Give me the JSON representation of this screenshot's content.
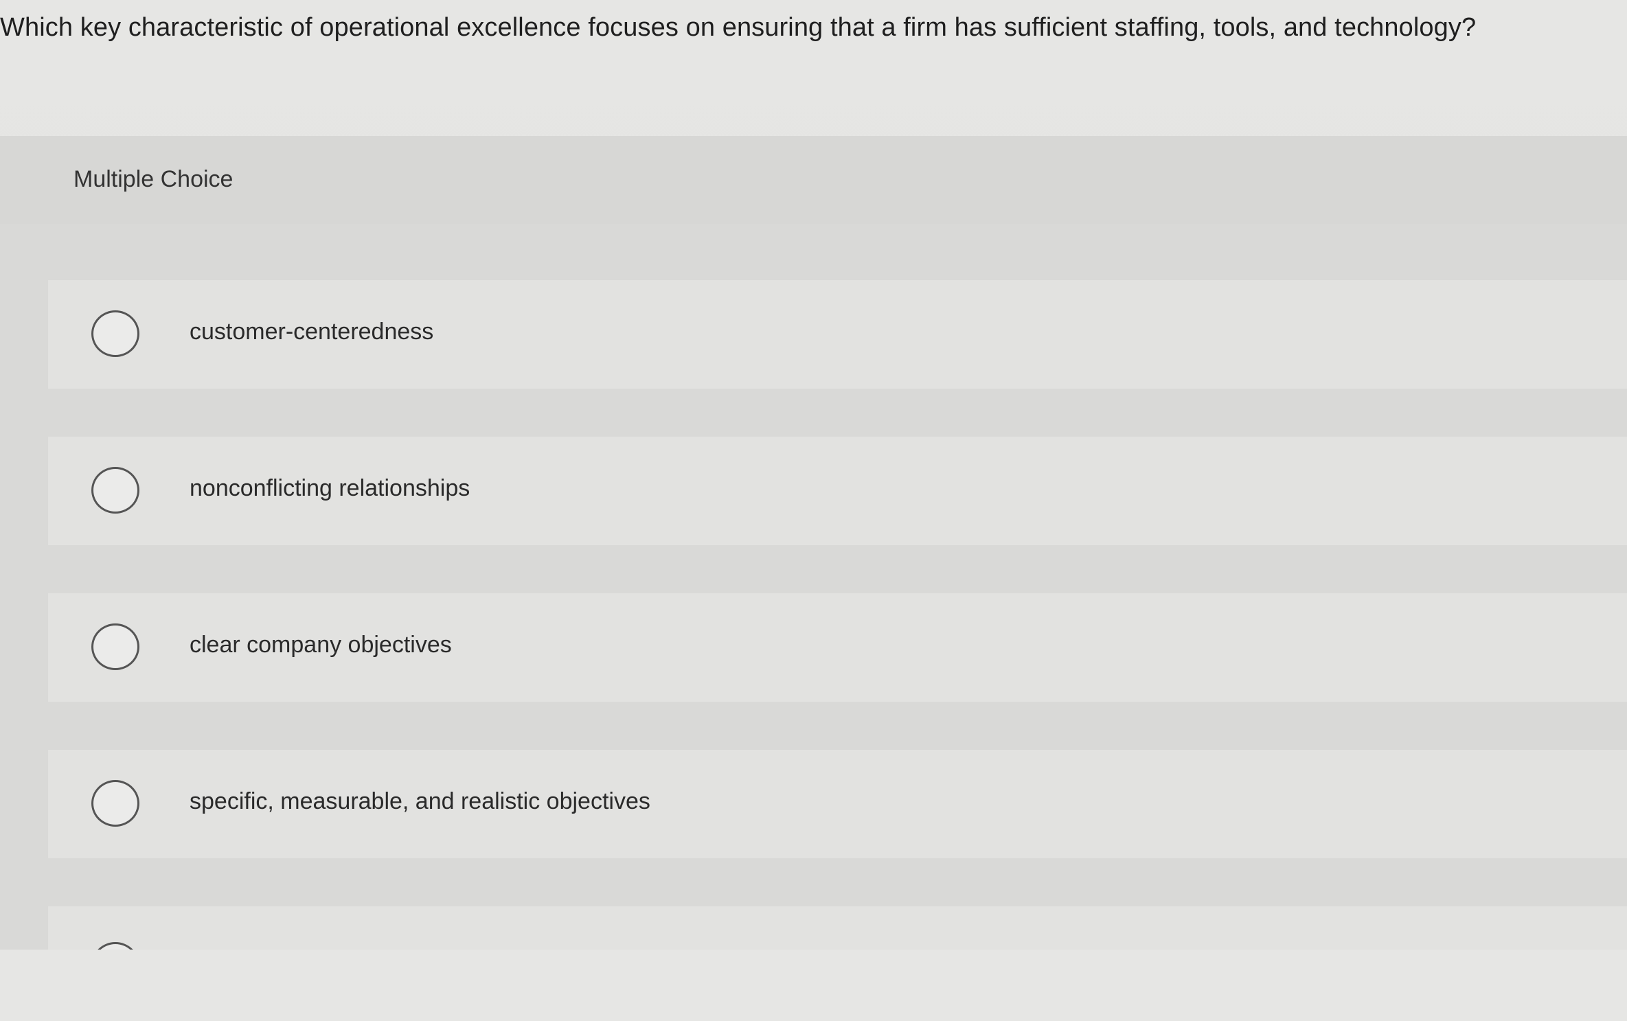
{
  "question": {
    "text": "Which key characteristic of operational excellence focuses on ensuring that a firm has sufficient staffing, tools, and technology?"
  },
  "multiple_choice": {
    "label": "Multiple Choice",
    "options": [
      {
        "text": "customer-centeredness",
        "selected": false
      },
      {
        "text": "nonconflicting relationships",
        "selected": false
      },
      {
        "text": "clear company objectives",
        "selected": false
      },
      {
        "text": "specific, measurable, and realistic objectives",
        "selected": false
      }
    ]
  },
  "colors": {
    "page_background": "#e3e3e1",
    "panel_background": "#d9d9d7",
    "option_background": "#e2e2e0",
    "radio_border": "#555555",
    "text": "#2b2b2b"
  },
  "icons": {
    "option_radio": "radio-circle-icon"
  }
}
